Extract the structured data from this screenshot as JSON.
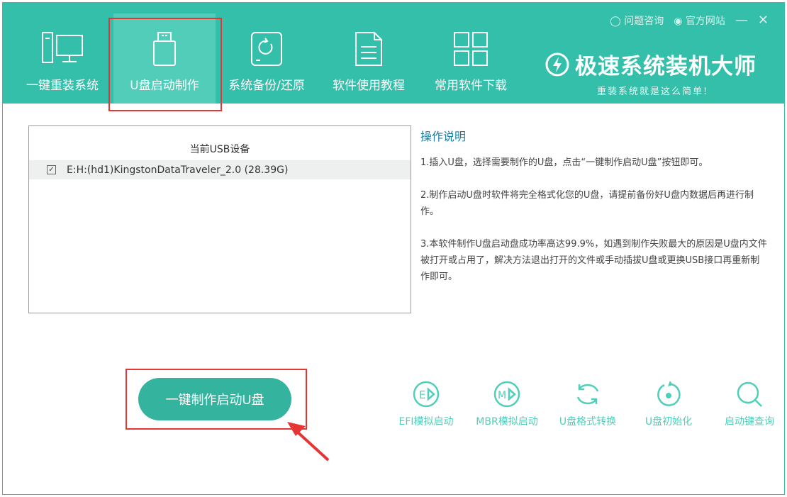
{
  "header": {
    "links": {
      "consult": "问题咨询",
      "website": "官方网站"
    },
    "brand": "极速系统装机大师",
    "slogan": "重装系统就是这么简单!"
  },
  "tabs": [
    {
      "label": "一键重装系统"
    },
    {
      "label": "U盘启动制作"
    },
    {
      "label": "系统备份/还原"
    },
    {
      "label": "软件使用教程"
    },
    {
      "label": "常用软件下载"
    }
  ],
  "devices": {
    "header": "当前USB设备",
    "items": [
      {
        "label": "E:H:(hd1)KingstonDataTraveler_2.0 (28.39G)",
        "checked": true
      }
    ]
  },
  "help": {
    "title": "操作说明",
    "items": [
      "1.插入U盘，选择需要制作的U盘，点击“一键制作启动U盘”按钮即可。",
      "2.制作启动U盘时软件将完全格式化您的U盘，请提前备份好U盘内数据后再进行制作。",
      "3.本软件制作U盘启动盘成功率高达99.9%，如遇到制作失败最大的原因是U盘内文件被打开或占用了，解决方法退出打开的文件或手动插拔U盘或更换USB接口再重新制作即可。"
    ]
  },
  "make_button": "一键制作启动U盘",
  "tools": [
    {
      "label": "EFI模拟启动",
      "icon": "E"
    },
    {
      "label": "MBR模拟启动",
      "icon": "M"
    },
    {
      "label": "U盘格式转换"
    },
    {
      "label": "U盘初始化"
    },
    {
      "label": "启动键查询"
    }
  ],
  "colors": {
    "accent": "#34bfaa",
    "annotation": "#e53535"
  }
}
